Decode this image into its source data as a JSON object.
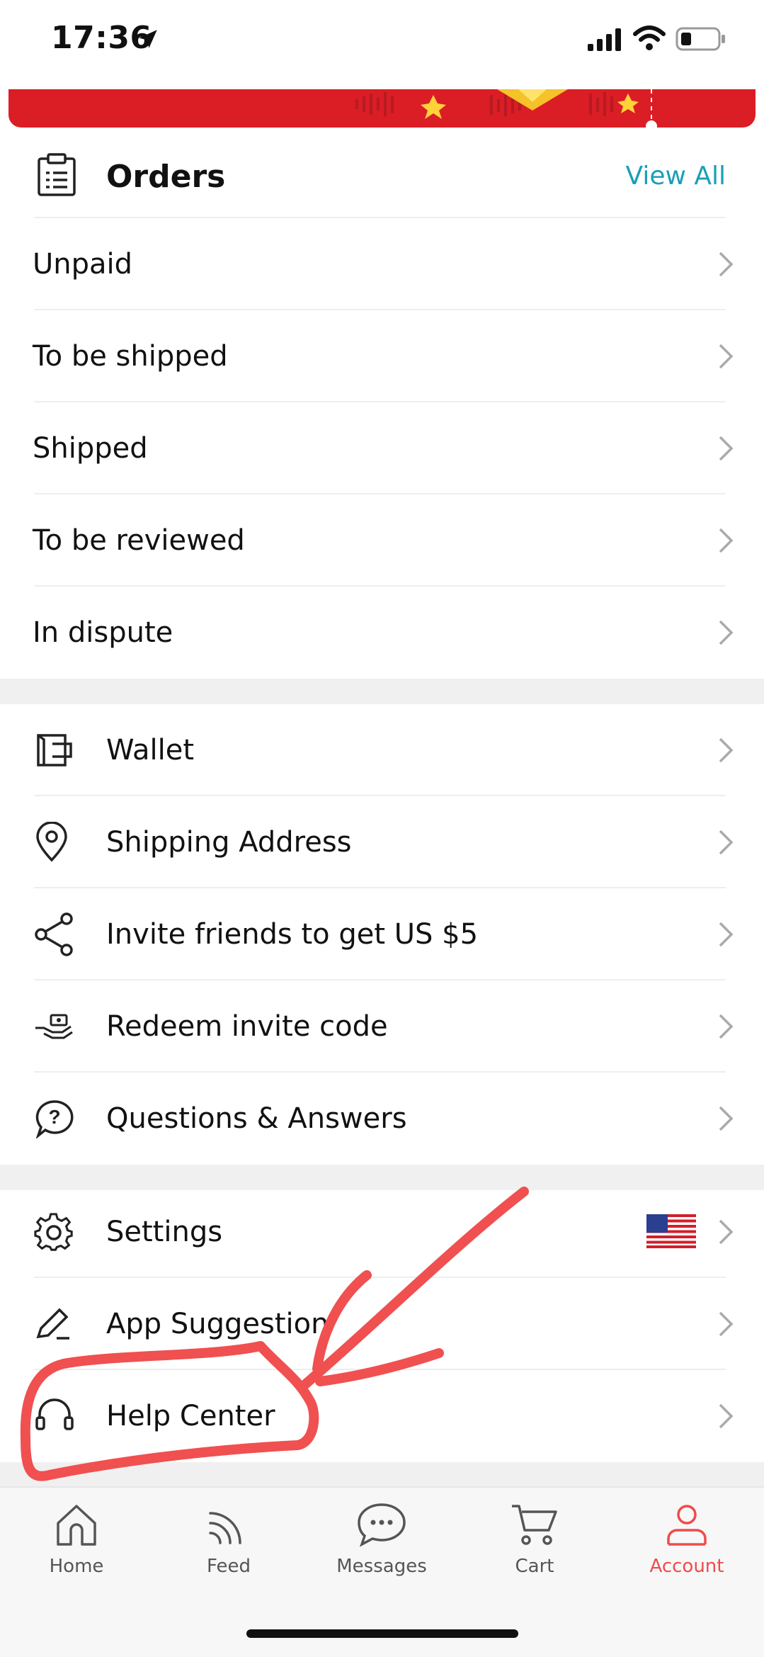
{
  "status_bar": {
    "time": "17:36"
  },
  "orders": {
    "title": "Orders",
    "view_all": "View All",
    "items": [
      {
        "label": "Unpaid"
      },
      {
        "label": "To be shipped"
      },
      {
        "label": "Shipped"
      },
      {
        "label": "To be reviewed"
      },
      {
        "label": "In dispute"
      }
    ]
  },
  "account_menu": {
    "items": [
      {
        "label": "Wallet",
        "icon": "wallet-icon"
      },
      {
        "label": "Shipping Address",
        "icon": "location-pin-icon"
      },
      {
        "label": "Invite friends to get US $5",
        "icon": "share-icon"
      },
      {
        "label": "Redeem invite code",
        "icon": "redeem-hand-icon"
      },
      {
        "label": "Questions & Answers",
        "icon": "question-bubble-icon"
      }
    ]
  },
  "settings_menu": {
    "items": [
      {
        "label": "Settings",
        "icon": "gear-icon",
        "badge": "us-flag-icon"
      },
      {
        "label": "App Suggestion",
        "icon": "pencil-icon"
      },
      {
        "label": "Help Center",
        "icon": "headset-icon"
      }
    ]
  },
  "tab_bar": {
    "tabs": [
      {
        "label": "Home",
        "icon": "home-icon"
      },
      {
        "label": "Feed",
        "icon": "feed-icon"
      },
      {
        "label": "Messages",
        "icon": "chat-bubble-icon"
      },
      {
        "label": "Cart",
        "icon": "cart-icon"
      },
      {
        "label": "Account",
        "icon": "account-icon",
        "active": true
      }
    ]
  },
  "colors": {
    "accent": "#f04b4b",
    "link": "#1aa0b5",
    "banner": "#db1d26",
    "annotation": "#f05050"
  }
}
